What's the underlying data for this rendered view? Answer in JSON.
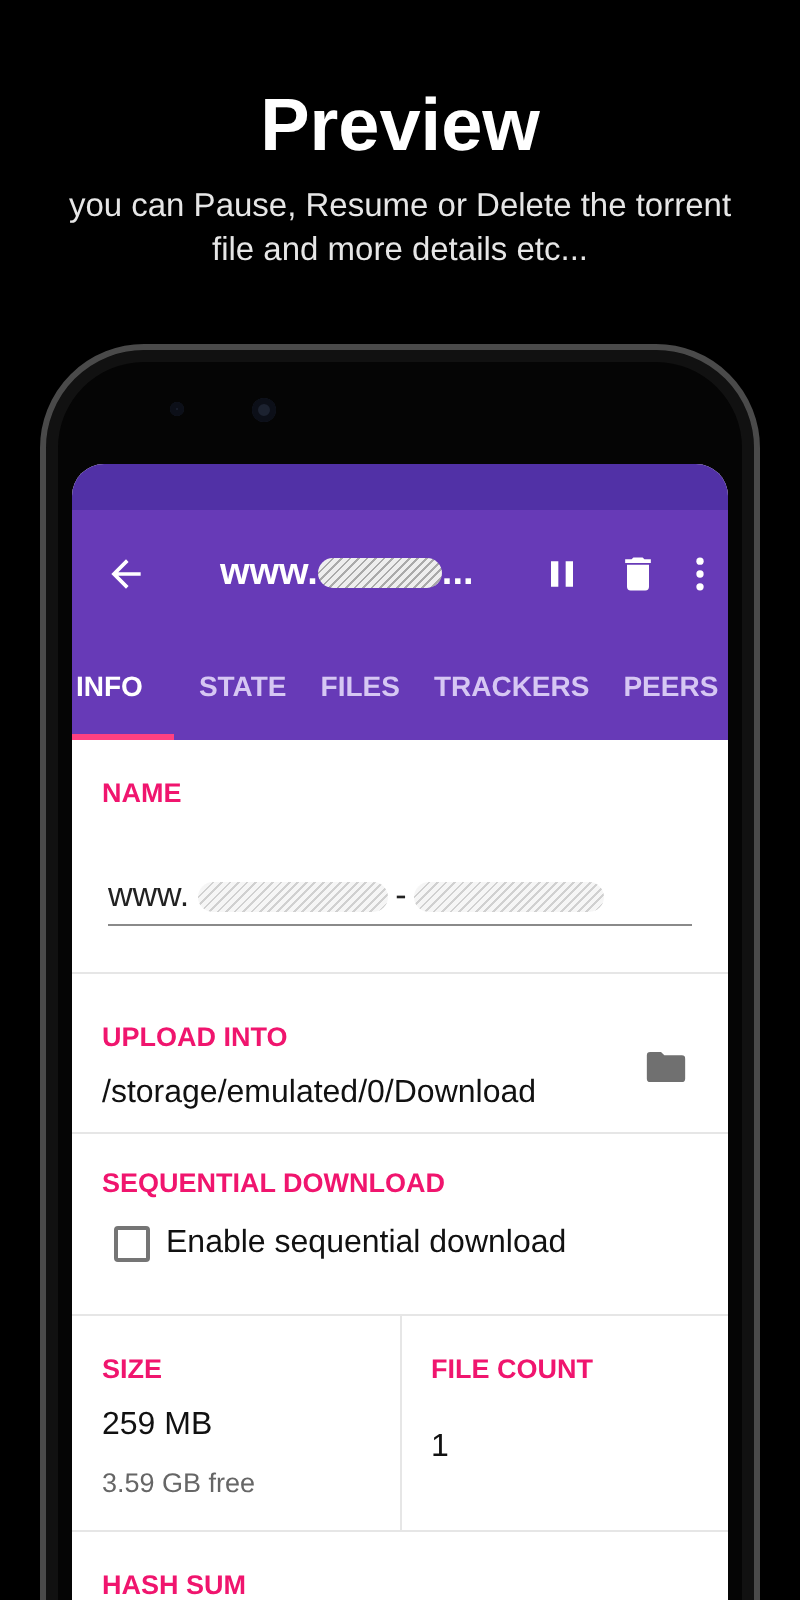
{
  "header": {
    "title": "Preview",
    "subtitle": "you can Pause, Resume or Delete the torrent file and more details etc..."
  },
  "toolbar": {
    "title": "www.",
    "title_suffix": "..."
  },
  "tabs": [
    {
      "label": "INFO",
      "selected": true
    },
    {
      "label": "STATE",
      "selected": false
    },
    {
      "label": "FILES",
      "selected": false
    },
    {
      "label": "TRACKERS",
      "selected": false
    },
    {
      "label": "PEERS",
      "selected": false
    }
  ],
  "name": {
    "label": "NAME",
    "value_parts": [
      "www.",
      "-"
    ]
  },
  "upload": {
    "label": "UPLOAD INTO",
    "path": "/storage/emulated/0/Download"
  },
  "sequential": {
    "label": "SEQUENTIAL DOWNLOAD",
    "checkbox_label": "Enable sequential download",
    "checked": false
  },
  "size": {
    "label": "SIZE",
    "value": "259 MB",
    "free": "3.59 GB free"
  },
  "file_count": {
    "label": "FILE COUNT",
    "value": "1"
  },
  "hash": {
    "label": "HASH SUM"
  }
}
